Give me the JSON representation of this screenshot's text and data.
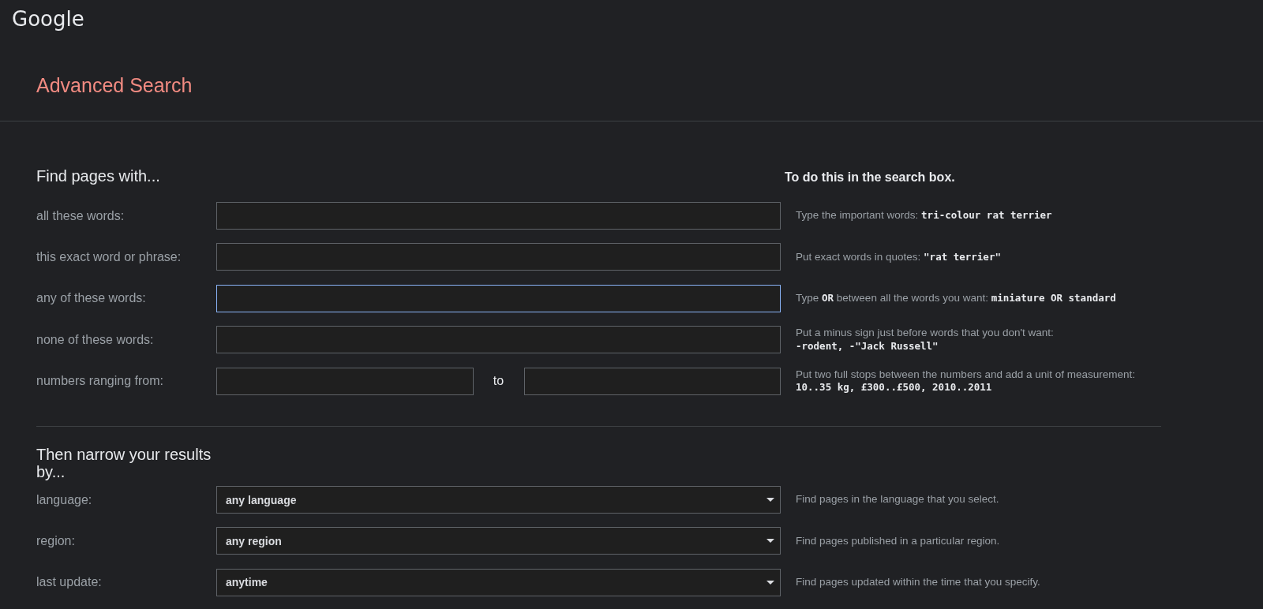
{
  "logo": "Google",
  "title": "Advanced Search",
  "find_section": {
    "heading": "Find pages with...",
    "hint_heading": "To do this in the search box.",
    "fields": [
      {
        "kind": "text",
        "label": "all these words:",
        "inputs": [
          {
            "focused": false
          }
        ],
        "hint": [
          "Type the important words: **tri-colour rat terrier**"
        ]
      },
      {
        "kind": "text",
        "label": "this exact word or phrase:",
        "inputs": [
          {
            "focused": false
          }
        ],
        "hint": [
          "Put exact words in quotes: **\"rat terrier\"**"
        ]
      },
      {
        "kind": "text",
        "label": "any of these words:",
        "inputs": [
          {
            "focused": true
          }
        ],
        "hint": [
          "Type **OR** between all the words you want: **miniature OR standard**"
        ]
      },
      {
        "kind": "text",
        "label": "none of these words:",
        "inputs": [
          {
            "focused": false
          }
        ],
        "hint": [
          "Put a minus sign just before words that you don't want:",
          "**-rodent, -\"Jack Russell\"**"
        ]
      },
      {
        "kind": "range",
        "label": "numbers ranging from:",
        "inputs": [
          {
            "focused": false
          },
          {
            "focused": false
          }
        ],
        "separator": "to",
        "hint": [
          "Put two full stops between the numbers and add a unit of measurement:",
          "**10..35 kg, £300..£500, 2010..2011**"
        ]
      }
    ]
  },
  "narrow_section": {
    "heading": "Then narrow your results by...",
    "filters": [
      {
        "label": "language:",
        "value": "any language",
        "hint": "Find pages in the language that you select."
      },
      {
        "label": "region:",
        "value": "any region",
        "hint": "Find pages published in a particular region."
      },
      {
        "label": "last update:",
        "value": "anytime",
        "hint": "Find pages updated within the time that you specify."
      }
    ]
  }
}
